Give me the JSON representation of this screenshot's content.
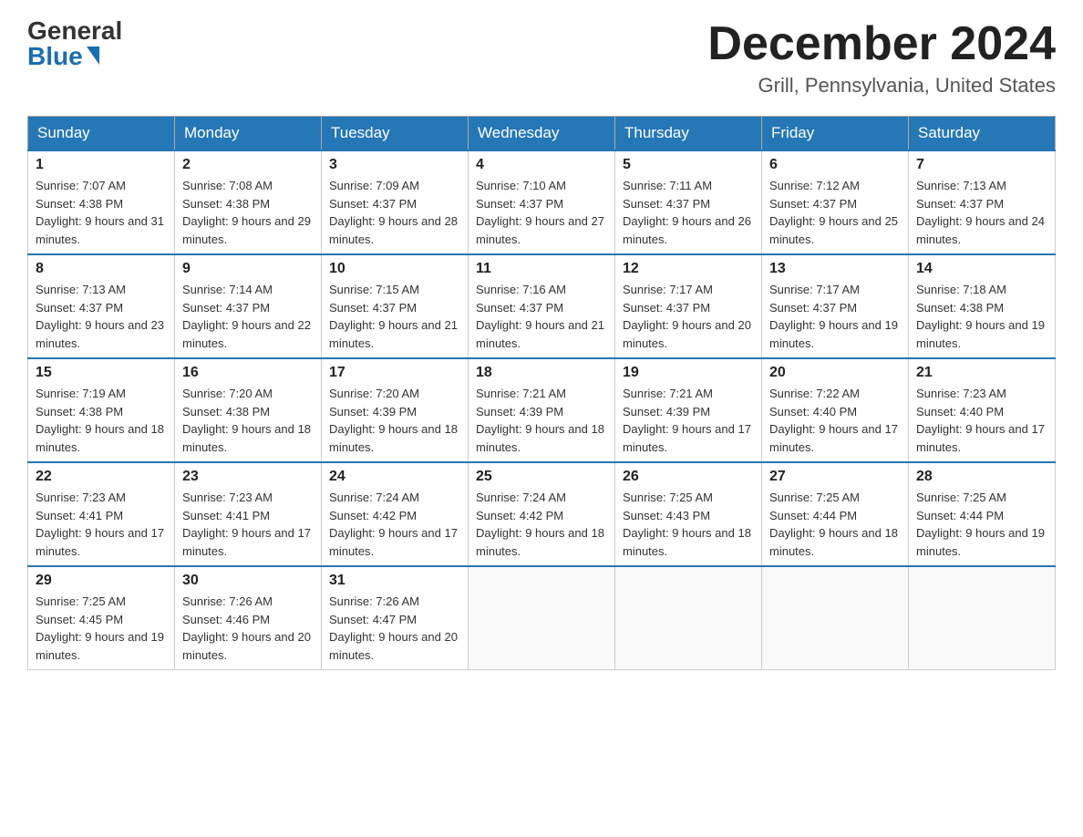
{
  "header": {
    "logo_general": "General",
    "logo_blue": "Blue",
    "month_title": "December 2024",
    "location": "Grill, Pennsylvania, United States"
  },
  "days_of_week": [
    "Sunday",
    "Monday",
    "Tuesday",
    "Wednesday",
    "Thursday",
    "Friday",
    "Saturday"
  ],
  "weeks": [
    [
      {
        "day": "1",
        "sunrise": "7:07 AM",
        "sunset": "4:38 PM",
        "daylight": "9 hours and 31 minutes."
      },
      {
        "day": "2",
        "sunrise": "7:08 AM",
        "sunset": "4:38 PM",
        "daylight": "9 hours and 29 minutes."
      },
      {
        "day": "3",
        "sunrise": "7:09 AM",
        "sunset": "4:37 PM",
        "daylight": "9 hours and 28 minutes."
      },
      {
        "day": "4",
        "sunrise": "7:10 AM",
        "sunset": "4:37 PM",
        "daylight": "9 hours and 27 minutes."
      },
      {
        "day": "5",
        "sunrise": "7:11 AM",
        "sunset": "4:37 PM",
        "daylight": "9 hours and 26 minutes."
      },
      {
        "day": "6",
        "sunrise": "7:12 AM",
        "sunset": "4:37 PM",
        "daylight": "9 hours and 25 minutes."
      },
      {
        "day": "7",
        "sunrise": "7:13 AM",
        "sunset": "4:37 PM",
        "daylight": "9 hours and 24 minutes."
      }
    ],
    [
      {
        "day": "8",
        "sunrise": "7:13 AM",
        "sunset": "4:37 PM",
        "daylight": "9 hours and 23 minutes."
      },
      {
        "day": "9",
        "sunrise": "7:14 AM",
        "sunset": "4:37 PM",
        "daylight": "9 hours and 22 minutes."
      },
      {
        "day": "10",
        "sunrise": "7:15 AM",
        "sunset": "4:37 PM",
        "daylight": "9 hours and 21 minutes."
      },
      {
        "day": "11",
        "sunrise": "7:16 AM",
        "sunset": "4:37 PM",
        "daylight": "9 hours and 21 minutes."
      },
      {
        "day": "12",
        "sunrise": "7:17 AM",
        "sunset": "4:37 PM",
        "daylight": "9 hours and 20 minutes."
      },
      {
        "day": "13",
        "sunrise": "7:17 AM",
        "sunset": "4:37 PM",
        "daylight": "9 hours and 19 minutes."
      },
      {
        "day": "14",
        "sunrise": "7:18 AM",
        "sunset": "4:38 PM",
        "daylight": "9 hours and 19 minutes."
      }
    ],
    [
      {
        "day": "15",
        "sunrise": "7:19 AM",
        "sunset": "4:38 PM",
        "daylight": "9 hours and 18 minutes."
      },
      {
        "day": "16",
        "sunrise": "7:20 AM",
        "sunset": "4:38 PM",
        "daylight": "9 hours and 18 minutes."
      },
      {
        "day": "17",
        "sunrise": "7:20 AM",
        "sunset": "4:39 PM",
        "daylight": "9 hours and 18 minutes."
      },
      {
        "day": "18",
        "sunrise": "7:21 AM",
        "sunset": "4:39 PM",
        "daylight": "9 hours and 18 minutes."
      },
      {
        "day": "19",
        "sunrise": "7:21 AM",
        "sunset": "4:39 PM",
        "daylight": "9 hours and 17 minutes."
      },
      {
        "day": "20",
        "sunrise": "7:22 AM",
        "sunset": "4:40 PM",
        "daylight": "9 hours and 17 minutes."
      },
      {
        "day": "21",
        "sunrise": "7:23 AM",
        "sunset": "4:40 PM",
        "daylight": "9 hours and 17 minutes."
      }
    ],
    [
      {
        "day": "22",
        "sunrise": "7:23 AM",
        "sunset": "4:41 PM",
        "daylight": "9 hours and 17 minutes."
      },
      {
        "day": "23",
        "sunrise": "7:23 AM",
        "sunset": "4:41 PM",
        "daylight": "9 hours and 17 minutes."
      },
      {
        "day": "24",
        "sunrise": "7:24 AM",
        "sunset": "4:42 PM",
        "daylight": "9 hours and 17 minutes."
      },
      {
        "day": "25",
        "sunrise": "7:24 AM",
        "sunset": "4:42 PM",
        "daylight": "9 hours and 18 minutes."
      },
      {
        "day": "26",
        "sunrise": "7:25 AM",
        "sunset": "4:43 PM",
        "daylight": "9 hours and 18 minutes."
      },
      {
        "day": "27",
        "sunrise": "7:25 AM",
        "sunset": "4:44 PM",
        "daylight": "9 hours and 18 minutes."
      },
      {
        "day": "28",
        "sunrise": "7:25 AM",
        "sunset": "4:44 PM",
        "daylight": "9 hours and 19 minutes."
      }
    ],
    [
      {
        "day": "29",
        "sunrise": "7:25 AM",
        "sunset": "4:45 PM",
        "daylight": "9 hours and 19 minutes."
      },
      {
        "day": "30",
        "sunrise": "7:26 AM",
        "sunset": "4:46 PM",
        "daylight": "9 hours and 20 minutes."
      },
      {
        "day": "31",
        "sunrise": "7:26 AM",
        "sunset": "4:47 PM",
        "daylight": "9 hours and 20 minutes."
      },
      null,
      null,
      null,
      null
    ]
  ]
}
